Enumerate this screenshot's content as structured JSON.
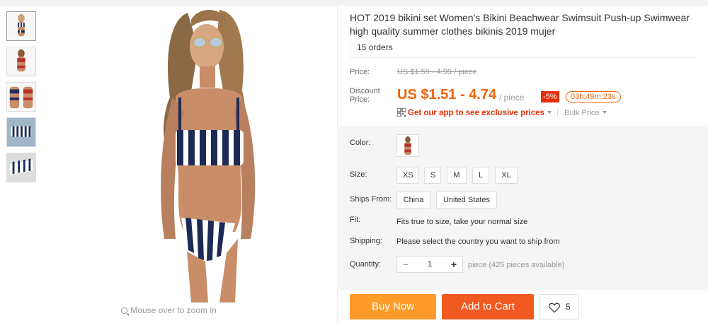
{
  "gallery": {
    "thumbnails": [
      "thumb-1",
      "thumb-2",
      "thumb-3",
      "thumb-4",
      "thumb-5"
    ],
    "zoom_hint": "Mouse over to zoom in"
  },
  "product": {
    "title": "HOT 2019 bikini set Women's Bikini Beachwear Swimsuit Push-up Swimwear high quality summer clothes bikinis 2019 mujer",
    "orders": "15 orders"
  },
  "price": {
    "price_label": "Price:",
    "original": "US $1.59 - 4.99 / piece",
    "discount_label": "Discount Price:",
    "discount_price": "US $1.51 - 4.74",
    "per_piece": "/ piece",
    "discount_badge": "-5%",
    "timer": "03h:49m:23s",
    "app_link": "Get our app to see exclusive prices",
    "bulk_price": "Bulk Price"
  },
  "options": {
    "color_label": "Color:",
    "size_label": "Size:",
    "sizes": [
      "XS",
      "S",
      "M",
      "L",
      "XL"
    ],
    "ships_from_label": "Ships From:",
    "ships_from": [
      "China",
      "United States"
    ],
    "fit_label": "Fit:",
    "fit_text": "Fits true to size, take your normal size",
    "shipping_label": "Shipping:",
    "shipping_text": "Please select the country you want to ship from",
    "quantity_label": "Quantity:",
    "quantity_minus": "−",
    "quantity_value": "1",
    "quantity_plus": "+",
    "availability": "piece (425 pieces available)"
  },
  "actions": {
    "buy_now": "Buy Now",
    "add_to_cart": "Add to Cart",
    "wishlist_count": "5"
  },
  "colors": {
    "accent_orange": "#f2630a",
    "buy_button": "#fe9b29",
    "cart_button": "#f05a21",
    "discount_red": "#e62e04"
  }
}
